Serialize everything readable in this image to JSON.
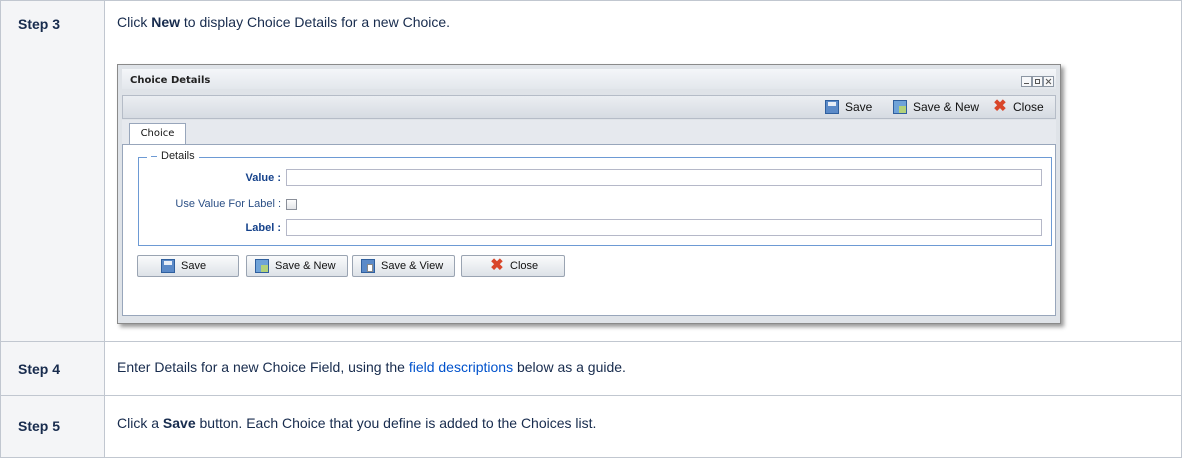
{
  "steps": [
    {
      "label": "Step 3",
      "pre": "Click ",
      "bold": "New",
      "post": " to display Choice Details for a new Choice."
    },
    {
      "label": "Step 4",
      "pre": "Enter Details for a new Choice Field, using the ",
      "link": "field descriptions",
      "post": " below as a guide."
    },
    {
      "label": "Step 5",
      "pre": "Click a ",
      "bold": "Save",
      "post": " button. Each Choice that you define is added to the Choices list."
    }
  ],
  "window": {
    "title": "Choice Details",
    "toolbar": {
      "save": "Save",
      "save_new": "Save & New",
      "close": "Close"
    },
    "tab": "Choice",
    "fieldset_legend": "Details",
    "fields": {
      "value_label": "Value :",
      "value": "",
      "use_value_label": "Use Value For Label :",
      "use_value_checked": false,
      "label_label": "Label :",
      "label_value": ""
    },
    "buttons": {
      "save": "Save",
      "save_new": "Save & New",
      "save_view": "Save & View",
      "close": "Close"
    }
  },
  "colors": {
    "label_bg": "#f4f5f7",
    "link": "#0052cc",
    "border": "#c1c7d0",
    "close_icon": "#d9462a"
  }
}
